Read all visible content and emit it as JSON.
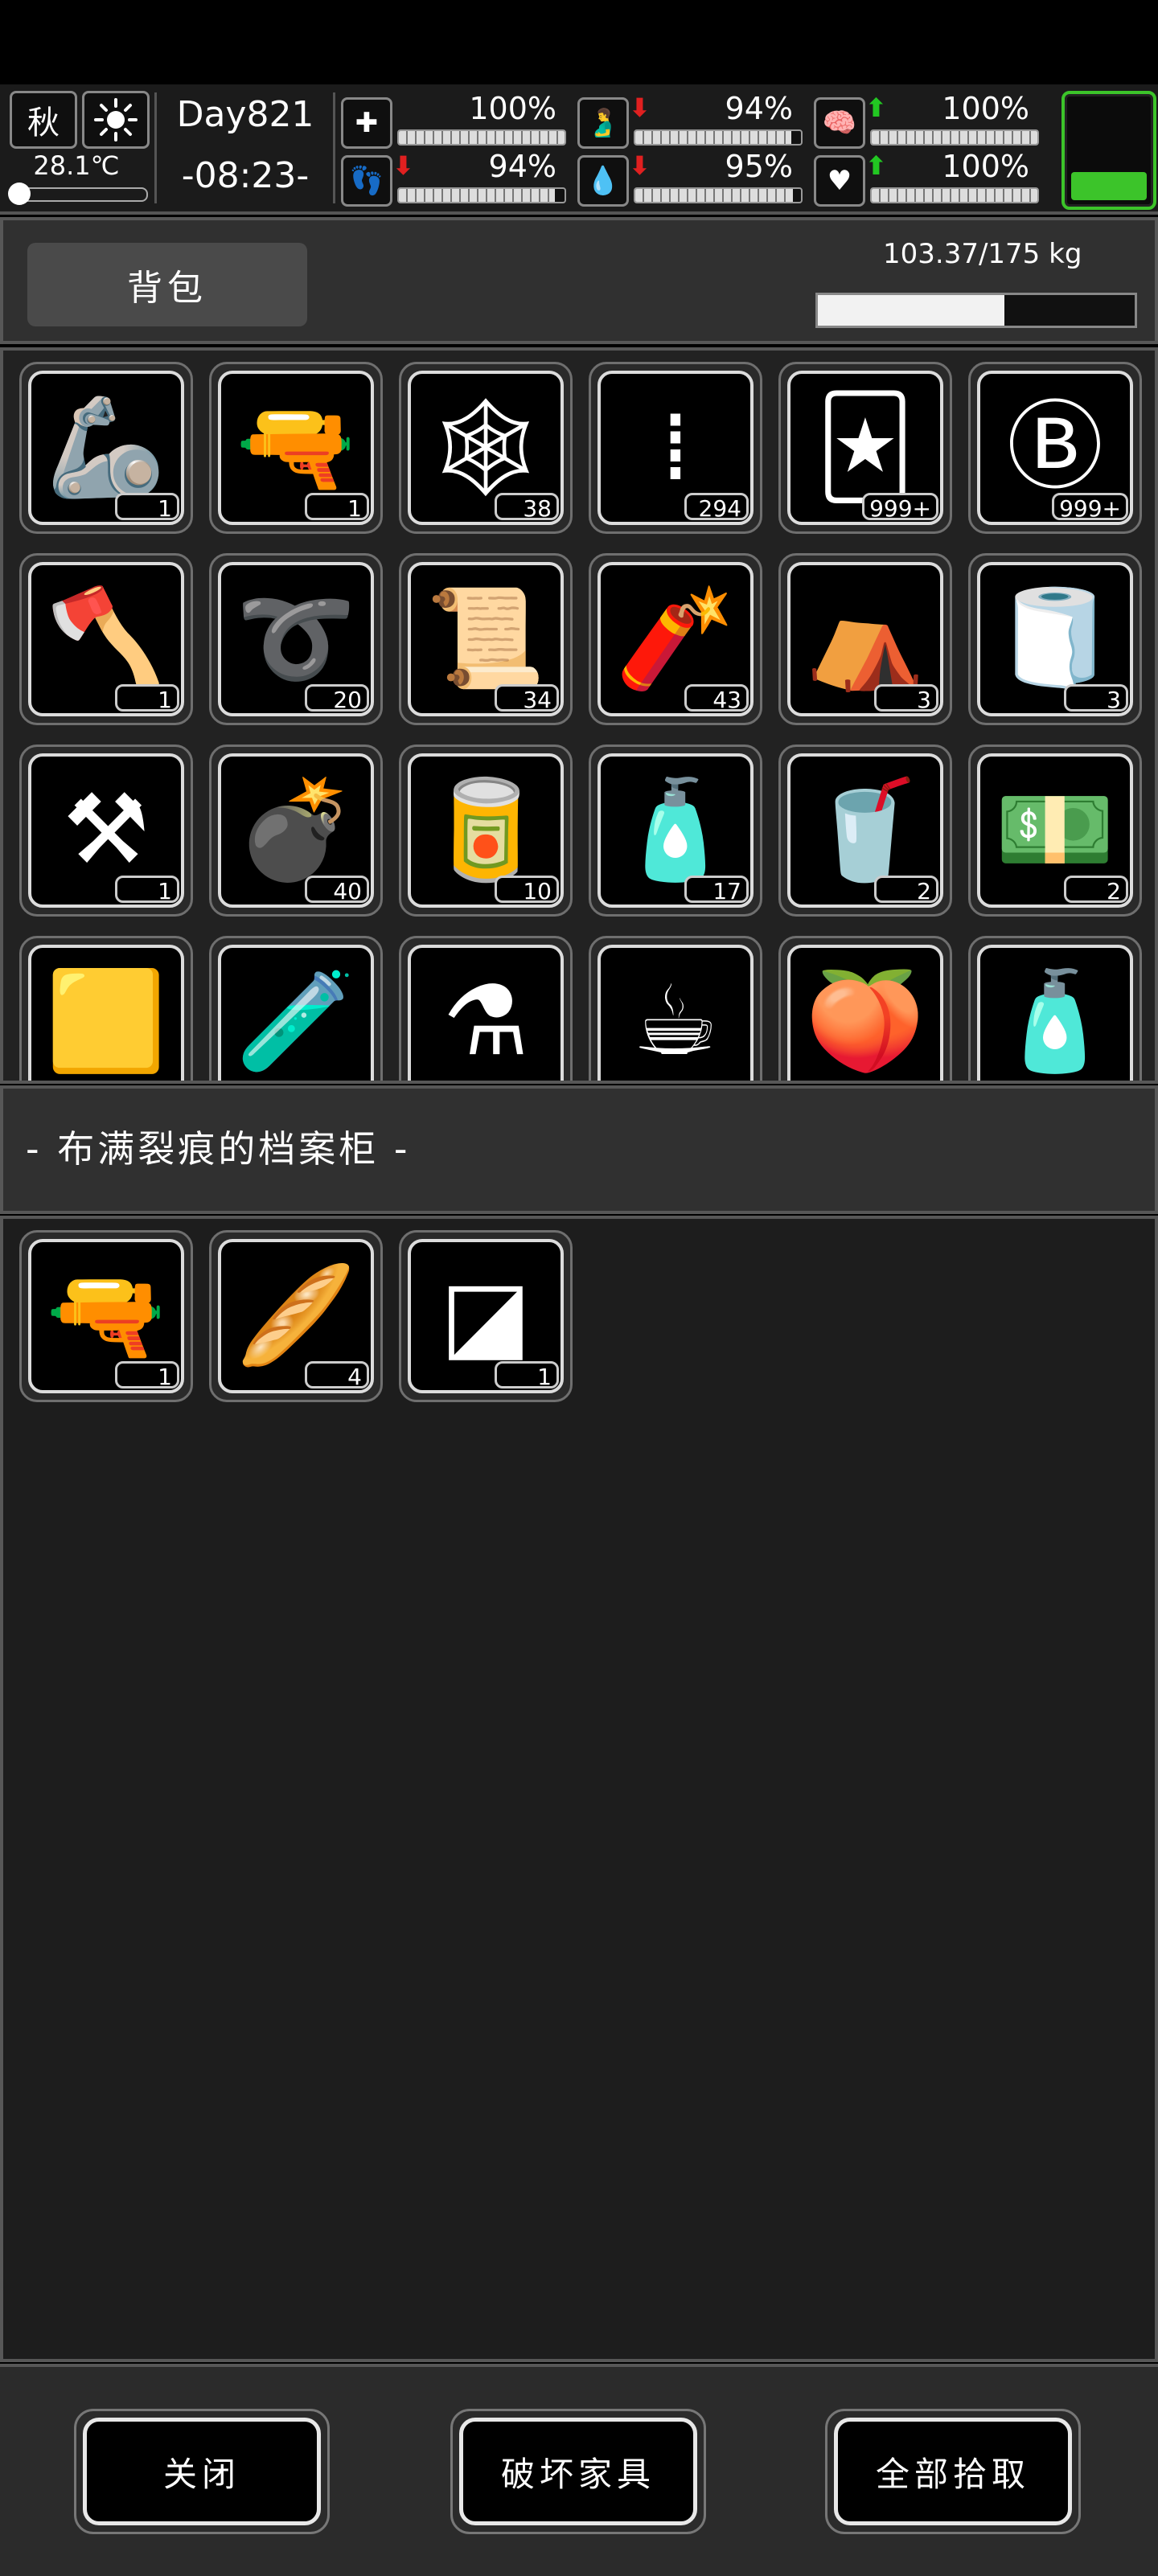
{
  "hud": {
    "season": "秋",
    "weather_icon": "sun-icon",
    "temperature": "28.1℃",
    "day": "Day821",
    "time": "-08:23-",
    "stats": [
      {
        "name": "health",
        "icon": "first-aid-icon",
        "value": "100%",
        "percent": 100,
        "trend": ""
      },
      {
        "name": "hunger",
        "icon": "stomach-icon",
        "value": "94%",
        "percent": 94,
        "trend": "down"
      },
      {
        "name": "sanity",
        "icon": "brain-icon",
        "value": "100%",
        "percent": 100,
        "trend": "up"
      },
      {
        "name": "stamina",
        "icon": "foot-icon",
        "value": "94%",
        "percent": 94,
        "trend": "down"
      },
      {
        "name": "thirst",
        "icon": "water-drop-icon",
        "value": "95%",
        "percent": 95,
        "trend": "down"
      },
      {
        "name": "mood",
        "icon": "heart-icon",
        "value": "100%",
        "percent": 100,
        "trend": "up"
      }
    ],
    "battery_percent": 30,
    "battery_color": "#3cc42a"
  },
  "header": {
    "tab_label": "背包",
    "weight": "103.37/175 kg",
    "weight_fraction": 0.59
  },
  "backpack_items": [
    {
      "icon": "robot-arm-icon",
      "glyph": "🦾",
      "count": "1"
    },
    {
      "icon": "minigun-icon",
      "glyph": "🔫",
      "count": "1"
    },
    {
      "icon": "net-icon",
      "glyph": "🕸",
      "count": "38"
    },
    {
      "icon": "bullets-icon",
      "glyph": "⁞",
      "count": "294"
    },
    {
      "icon": "poster-icon",
      "glyph": "🃏",
      "count": "999+"
    },
    {
      "icon": "coin-icon",
      "glyph": "Ⓑ",
      "count": "999+"
    },
    {
      "icon": "axe-icon",
      "glyph": "🪓",
      "count": "1"
    },
    {
      "icon": "rope-icon",
      "glyph": "➰",
      "count": "20"
    },
    {
      "icon": "bandage-icon",
      "glyph": "📜",
      "count": "34"
    },
    {
      "icon": "grenade-can-icon",
      "glyph": "🧨",
      "count": "43"
    },
    {
      "icon": "cloth-icon",
      "glyph": "⛺",
      "count": "3"
    },
    {
      "icon": "towel-icon",
      "glyph": "🧻",
      "count": "3"
    },
    {
      "icon": "shovel-icon",
      "glyph": "⚒",
      "count": "1"
    },
    {
      "icon": "grenade-icon",
      "glyph": "💣",
      "count": "40"
    },
    {
      "icon": "canned-food-icon",
      "glyph": "🥫",
      "count": "10"
    },
    {
      "icon": "water-bottle-icon",
      "glyph": "🧴",
      "count": "17"
    },
    {
      "icon": "drink-icon",
      "glyph": "🥤",
      "count": "2"
    },
    {
      "icon": "cash-icon",
      "glyph": "💵",
      "count": "2"
    },
    {
      "icon": "yellow-cloth-icon",
      "glyph": "🟨",
      "count": ""
    },
    {
      "icon": "test-tube-icon",
      "glyph": "🧪",
      "count": ""
    },
    {
      "icon": "flask-icon",
      "glyph": "⚗",
      "count": ""
    },
    {
      "icon": "coffee-beans-icon",
      "glyph": "☕",
      "count": ""
    },
    {
      "icon": "fruit-icon",
      "glyph": "🍑",
      "count": ""
    },
    {
      "icon": "spray-bottle-icon",
      "glyph": "🧴",
      "count": ""
    }
  ],
  "container": {
    "title": "- 布满裂痕的档案柜 -",
    "items": [
      {
        "icon": "sniper-rifle-icon",
        "glyph": "🔫",
        "count": "1"
      },
      {
        "icon": "bread-icon",
        "glyph": "🥖",
        "count": "4"
      },
      {
        "icon": "broken-glass-icon",
        "glyph": "◪",
        "count": "1"
      }
    ]
  },
  "footer": {
    "close": "关闭",
    "destroy": "破坏家具",
    "take_all": "全部拾取"
  }
}
